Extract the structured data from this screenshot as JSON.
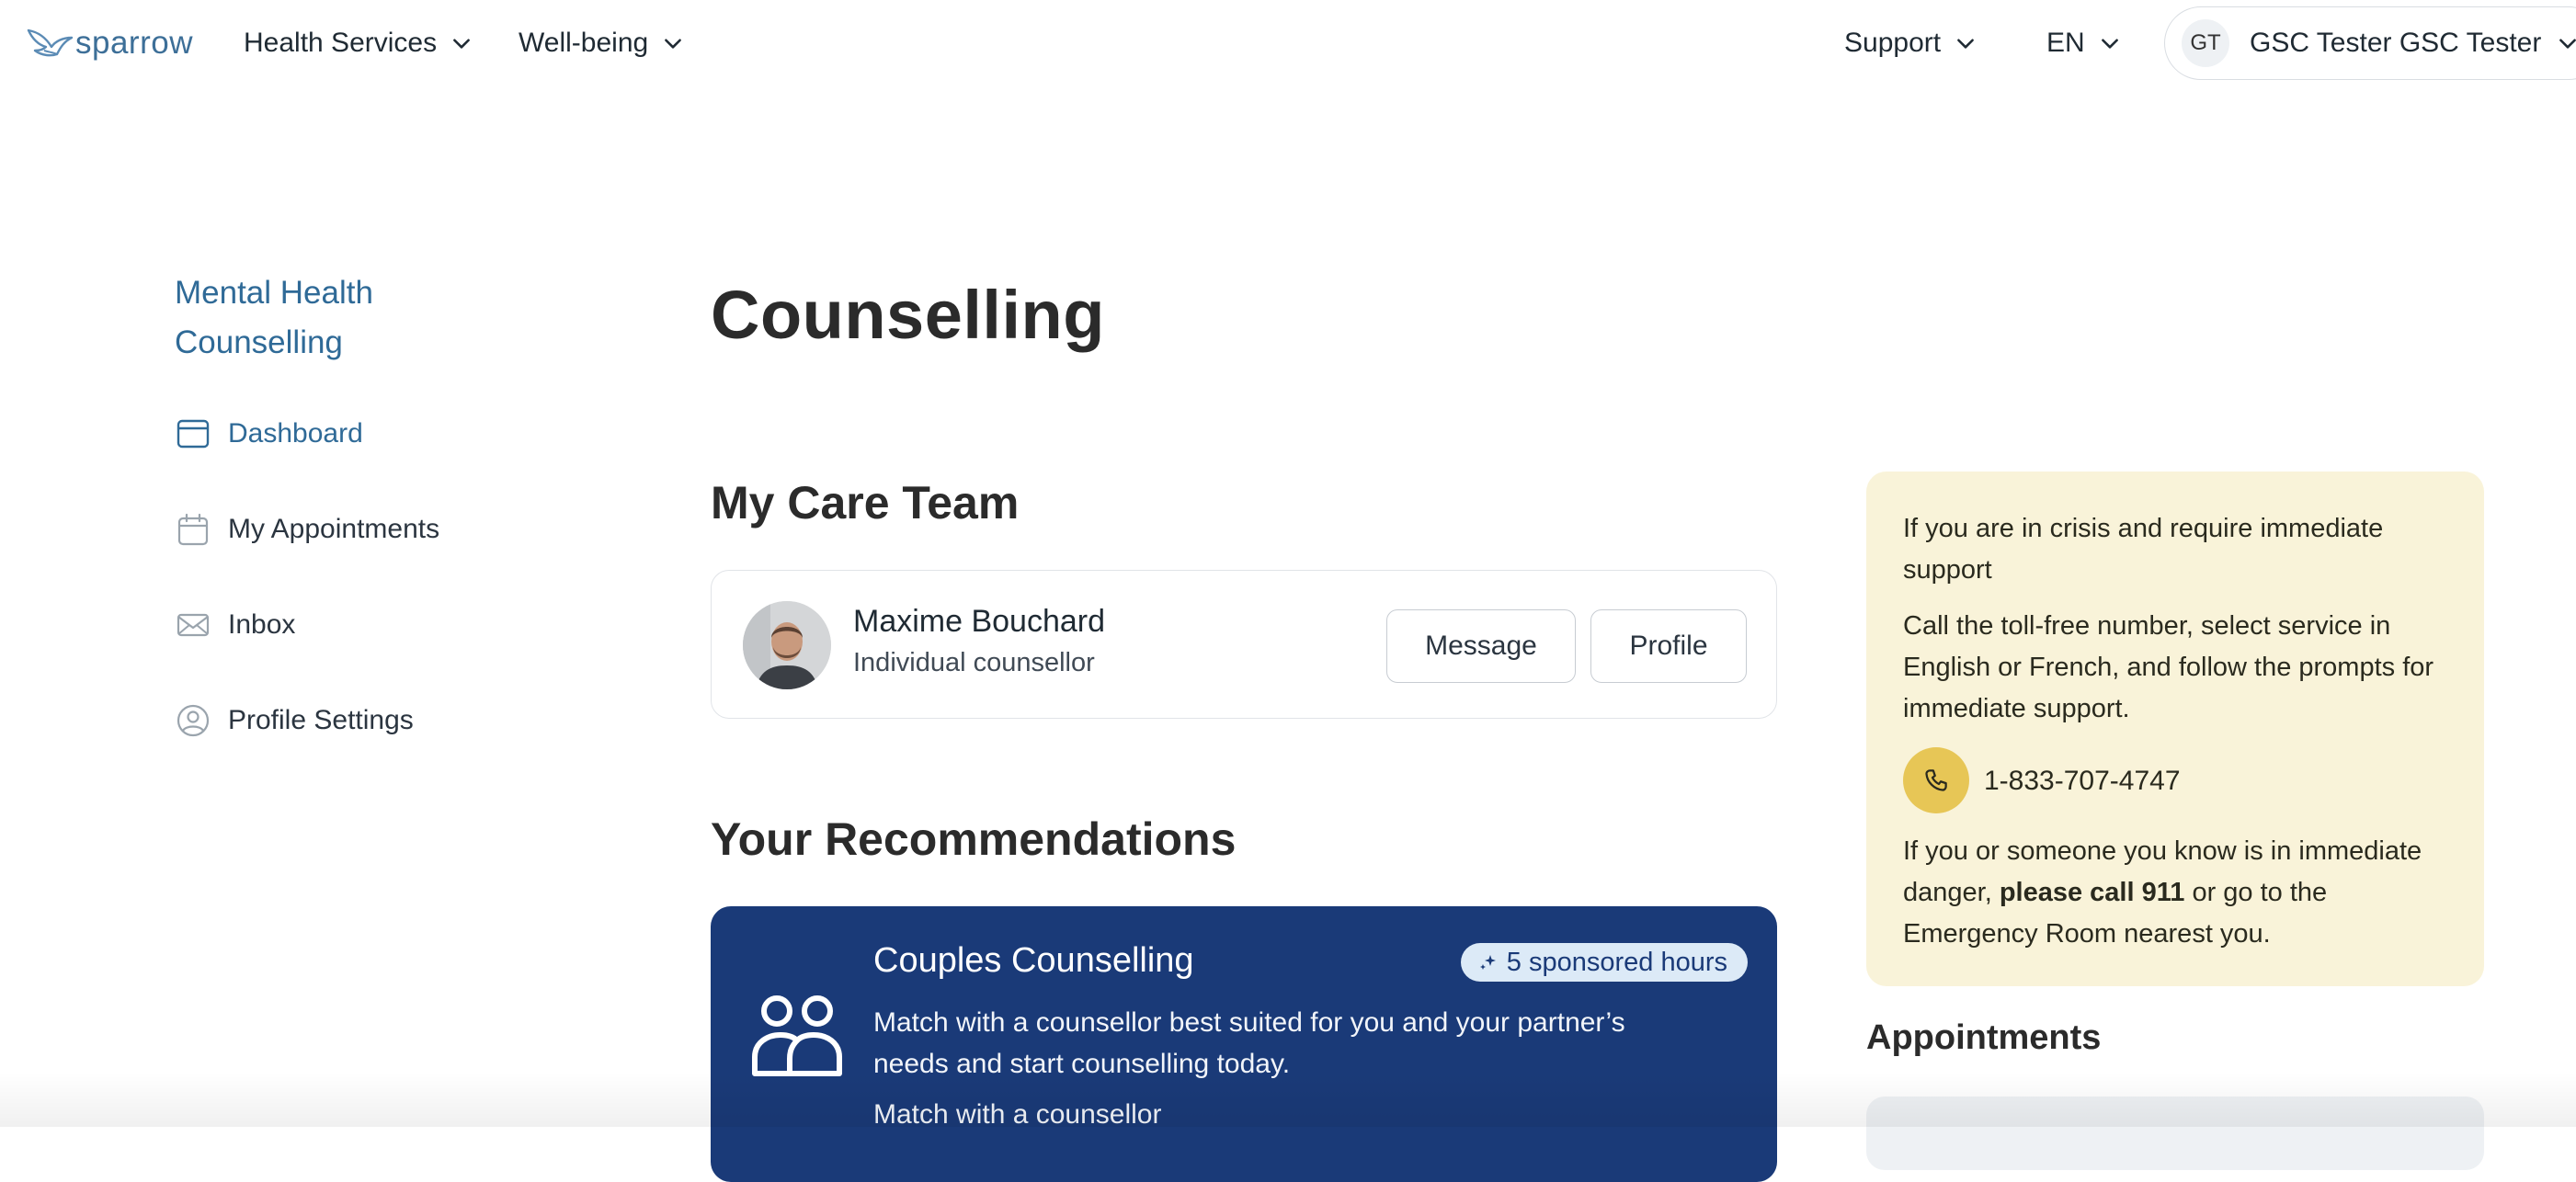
{
  "brand": {
    "logo_text": "sparrow",
    "accent": "#2f6a97",
    "navy": "#1a3a78",
    "crisis_bg": "#f9f3d9",
    "phone_badge": "#e7c656"
  },
  "topnav": {
    "health_services": "Health Services",
    "well_being": "Well-being",
    "support": "Support",
    "language": "EN",
    "user_initials": "GT",
    "user_name": "GSC Tester GSC Tester"
  },
  "sidebar": {
    "title_line1": "Mental Health",
    "title_line2": "Counselling",
    "items": [
      {
        "label": "Dashboard",
        "icon": "dashboard-icon",
        "active": true
      },
      {
        "label": "My Appointments",
        "icon": "calendar-icon",
        "active": false
      },
      {
        "label": "Inbox",
        "icon": "envelope-icon",
        "active": false
      },
      {
        "label": "Profile Settings",
        "icon": "user-circle-icon",
        "active": false
      }
    ]
  },
  "main": {
    "title": "Counselling",
    "care_team": {
      "heading": "My Care Team",
      "member_name": "Maxime Bouchard",
      "member_role": "Individual counsellor",
      "message_label": "Message",
      "profile_label": "Profile"
    },
    "recommendations": {
      "heading": "Your Recommendations",
      "card_title": "Couples Counselling",
      "badge": "5 sponsored hours",
      "description": "Match with a counsellor best suited for you and your partner’s needs and start counselling today.",
      "link": "Match with a counsellor"
    }
  },
  "crisis": {
    "p1": "If you are in crisis and require immediate support",
    "p2": "Call the toll-free number, select service in English or French, and follow the prompts for immediate support.",
    "phone": "1-833-707-4747",
    "p3_start": "If you or someone you know is in immediate danger, ",
    "p3_bold": "please call 911",
    "p3_end": " or go to the Emergency Room nearest you."
  },
  "appointments": {
    "heading": "Appointments"
  }
}
